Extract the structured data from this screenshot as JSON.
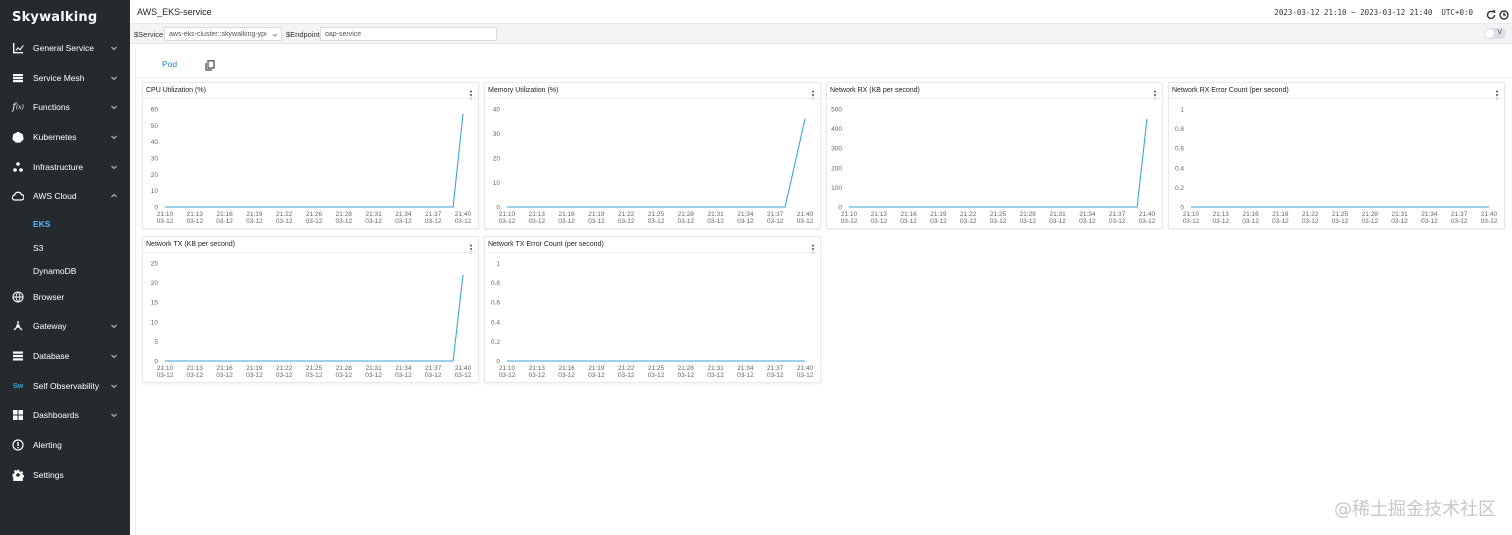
{
  "logo": "Skywalking",
  "sidebar": {
    "items": [
      {
        "label": "General Service",
        "icon": "chart-icon",
        "chevron": "down"
      },
      {
        "label": "Service Mesh",
        "icon": "mesh-icon",
        "chevron": "down"
      },
      {
        "label": "Functions",
        "icon": "function-icon",
        "chevron": "down"
      },
      {
        "label": "Kubernetes",
        "icon": "kubernetes-icon",
        "chevron": "down"
      },
      {
        "label": "Infrastructure",
        "icon": "infrastructure-icon",
        "chevron": "down"
      },
      {
        "label": "AWS Cloud",
        "icon": "cloud-icon",
        "chevron": "up"
      },
      {
        "label": "Browser",
        "icon": "globe-icon",
        "chevron": ""
      },
      {
        "label": "Gateway",
        "icon": "gateway-icon",
        "chevron": "down"
      },
      {
        "label": "Database",
        "icon": "database-icon",
        "chevron": "down"
      },
      {
        "label": "Self Observability",
        "icon": "self-observability-icon",
        "chevron": "down"
      },
      {
        "label": "Dashboards",
        "icon": "dashboard-icon",
        "chevron": "down"
      },
      {
        "label": "Alerting",
        "icon": "alert-icon",
        "chevron": ""
      },
      {
        "label": "Settings",
        "icon": "gear-icon",
        "chevron": ""
      }
    ],
    "aws_sub": [
      {
        "label": "EKS",
        "active": true
      },
      {
        "label": "S3",
        "active": false
      },
      {
        "label": "DynamoDB",
        "active": false
      }
    ]
  },
  "header": {
    "title": "AWS_EKS-service",
    "time_range": "2023-03-12 21:10 ~ 2023-03-12 21:40",
    "timezone": "UTC+0:0"
  },
  "selectors": {
    "service_label": "$Service",
    "service_value": "aws-eks-cluster::skywalking-ypi",
    "endpoint_label": "$Endpoint",
    "endpoint_value": "oap-service",
    "toggle_label": "V"
  },
  "tabs": {
    "pod": "Pod"
  },
  "watermark": "@稀土掘金技术社区",
  "colors": {
    "line": "#3aa7d6",
    "sidebar_bg": "#252a2f",
    "active": "#5ab4ff"
  },
  "chart_data": [
    {
      "type": "line",
      "title": "CPU Utilization (%)",
      "x": [
        "21:10\n03-12",
        "21:13\n03-12",
        "21:16\n03-12",
        "21:19\n03-12",
        "21:22\n03-12",
        "21:26\n03-12",
        "21:28\n03-12",
        "21:31\n03-12",
        "21:34\n03-12",
        "21:37\n03-12",
        "21:40\n03-12"
      ],
      "yticks": [
        0,
        10,
        20,
        30,
        40,
        50,
        60
      ],
      "ylim": [
        0,
        60
      ],
      "series": [
        {
          "values": [
            0,
            0,
            0,
            0,
            0,
            0,
            0,
            0,
            0,
            0,
            0,
            0,
            0,
            0,
            0,
            0,
            0,
            0,
            0,
            0,
            0,
            0,
            0,
            0,
            0,
            0,
            0,
            0,
            0,
            0,
            57
          ]
        }
      ]
    },
    {
      "type": "line",
      "title": "Memory Utilization (%)",
      "x": [
        "21:10\n03-12",
        "21:13\n03-12",
        "21:16\n03-12",
        "21:19\n03-12",
        "21:22\n03-12",
        "21:25\n03-12",
        "21:28\n03-12",
        "21:31\n03-12",
        "21:34\n03-12",
        "21:37\n03-12",
        "21:40\n03-12"
      ],
      "yticks": [
        0,
        10,
        20,
        30,
        40
      ],
      "ylim": [
        0,
        40
      ],
      "series": [
        {
          "values": [
            0,
            0,
            0,
            0,
            0,
            0,
            0,
            0,
            0,
            0,
            0,
            0,
            0,
            0,
            0,
            0,
            0,
            0,
            0,
            0,
            0,
            0,
            0,
            0,
            0,
            0,
            0,
            0,
            0,
            18,
            36
          ]
        }
      ]
    },
    {
      "type": "line",
      "title": "Network RX (KB per second)",
      "x": [
        "21:10\n03-12",
        "21:13\n03-12",
        "21:16\n03-12",
        "21:19\n03-12",
        "21:22\n03-12",
        "21:25\n03-12",
        "21:28\n03-12",
        "21:31\n03-12",
        "21:34\n03-12",
        "21:37\n03-12",
        "21:40\n03-12"
      ],
      "yticks": [
        0,
        100,
        200,
        300,
        400,
        500
      ],
      "ylim": [
        0,
        500
      ],
      "series": [
        {
          "values": [
            0,
            0,
            0,
            0,
            0,
            0,
            0,
            0,
            0,
            0,
            0,
            0,
            0,
            0,
            0,
            0,
            0,
            0,
            0,
            0,
            0,
            0,
            0,
            0,
            0,
            0,
            0,
            0,
            0,
            0,
            450
          ]
        }
      ]
    },
    {
      "type": "line",
      "title": "Network RX Error Count (per second)",
      "x": [
        "21:10\n03-12",
        "21:13\n03-12",
        "21:16\n03-12",
        "21:19\n03-12",
        "21:22\n03-12",
        "21:25\n03-12",
        "21:28\n03-12",
        "21:31\n03-12",
        "21:34\n03-12",
        "21:37\n03-12",
        "21:40\n03-12"
      ],
      "yticks": [
        0,
        0.2,
        0.4,
        0.6,
        0.8,
        1
      ],
      "ylim": [
        0,
        1
      ],
      "series": [
        {
          "values": [
            0,
            0,
            0,
            0,
            0,
            0,
            0,
            0,
            0,
            0,
            0,
            0,
            0,
            0,
            0,
            0,
            0,
            0,
            0,
            0,
            0,
            0,
            0,
            0,
            0,
            0,
            0,
            0,
            0,
            0,
            0
          ]
        }
      ]
    },
    {
      "type": "line",
      "title": "Network TX (KB per second)",
      "x": [
        "21:10\n03-12",
        "21:13\n03-12",
        "21:16\n03-12",
        "21:19\n03-12",
        "21:22\n03-12",
        "21:25\n03-12",
        "21:28\n03-12",
        "21:31\n03-12",
        "21:34\n03-12",
        "21:37\n03-12",
        "21:40\n03-12"
      ],
      "yticks": [
        0,
        5,
        10,
        15,
        20,
        25
      ],
      "ylim": [
        0,
        25
      ],
      "series": [
        {
          "values": [
            0,
            0,
            0,
            0,
            0,
            0,
            0,
            0,
            0,
            0,
            0,
            0,
            0,
            0,
            0,
            0,
            0,
            0,
            0,
            0,
            0,
            0,
            0,
            0,
            0,
            0,
            0,
            0,
            0,
            0,
            22
          ]
        }
      ]
    },
    {
      "type": "line",
      "title": "Network TX Error Count (per second)",
      "x": [
        "21:10\n03-12",
        "21:13\n03-12",
        "21:16\n03-12",
        "21:19\n03-12",
        "21:22\n03-12",
        "21:25\n03-12",
        "21:28\n03-12",
        "21:31\n03-12",
        "21:34\n03-12",
        "21:37\n03-12",
        "21:40\n03-12"
      ],
      "yticks": [
        0,
        0.2,
        0.4,
        0.6,
        0.8,
        1
      ],
      "ylim": [
        0,
        1
      ],
      "series": [
        {
          "values": [
            0,
            0,
            0,
            0,
            0,
            0,
            0,
            0,
            0,
            0,
            0,
            0,
            0,
            0,
            0,
            0,
            0,
            0,
            0,
            0,
            0,
            0,
            0,
            0,
            0,
            0,
            0,
            0,
            0,
            0,
            0
          ]
        }
      ]
    }
  ]
}
